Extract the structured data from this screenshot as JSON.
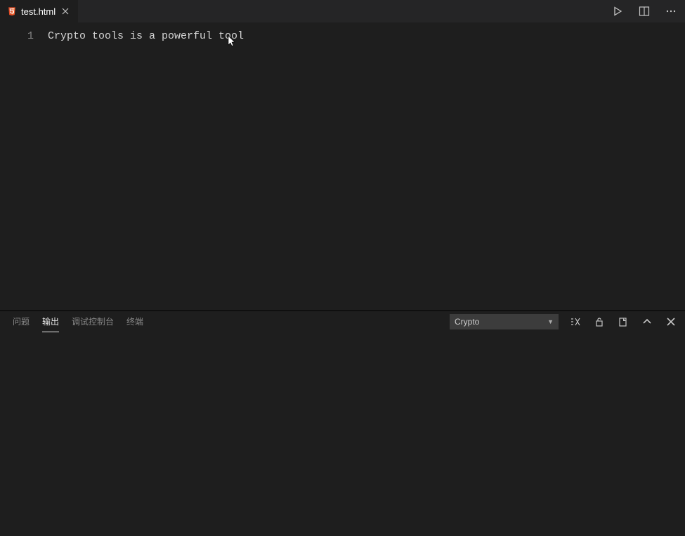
{
  "tabs": {
    "items": [
      {
        "label": "test.html"
      }
    ]
  },
  "editor": {
    "lines": [
      {
        "number": "1",
        "text": "Crypto tools is a powerful tool"
      }
    ]
  },
  "panel": {
    "tabs": {
      "problems": "问题",
      "output": "输出",
      "debug_console": "调试控制台",
      "terminal": "终端"
    },
    "output_channel": "Crypto"
  }
}
